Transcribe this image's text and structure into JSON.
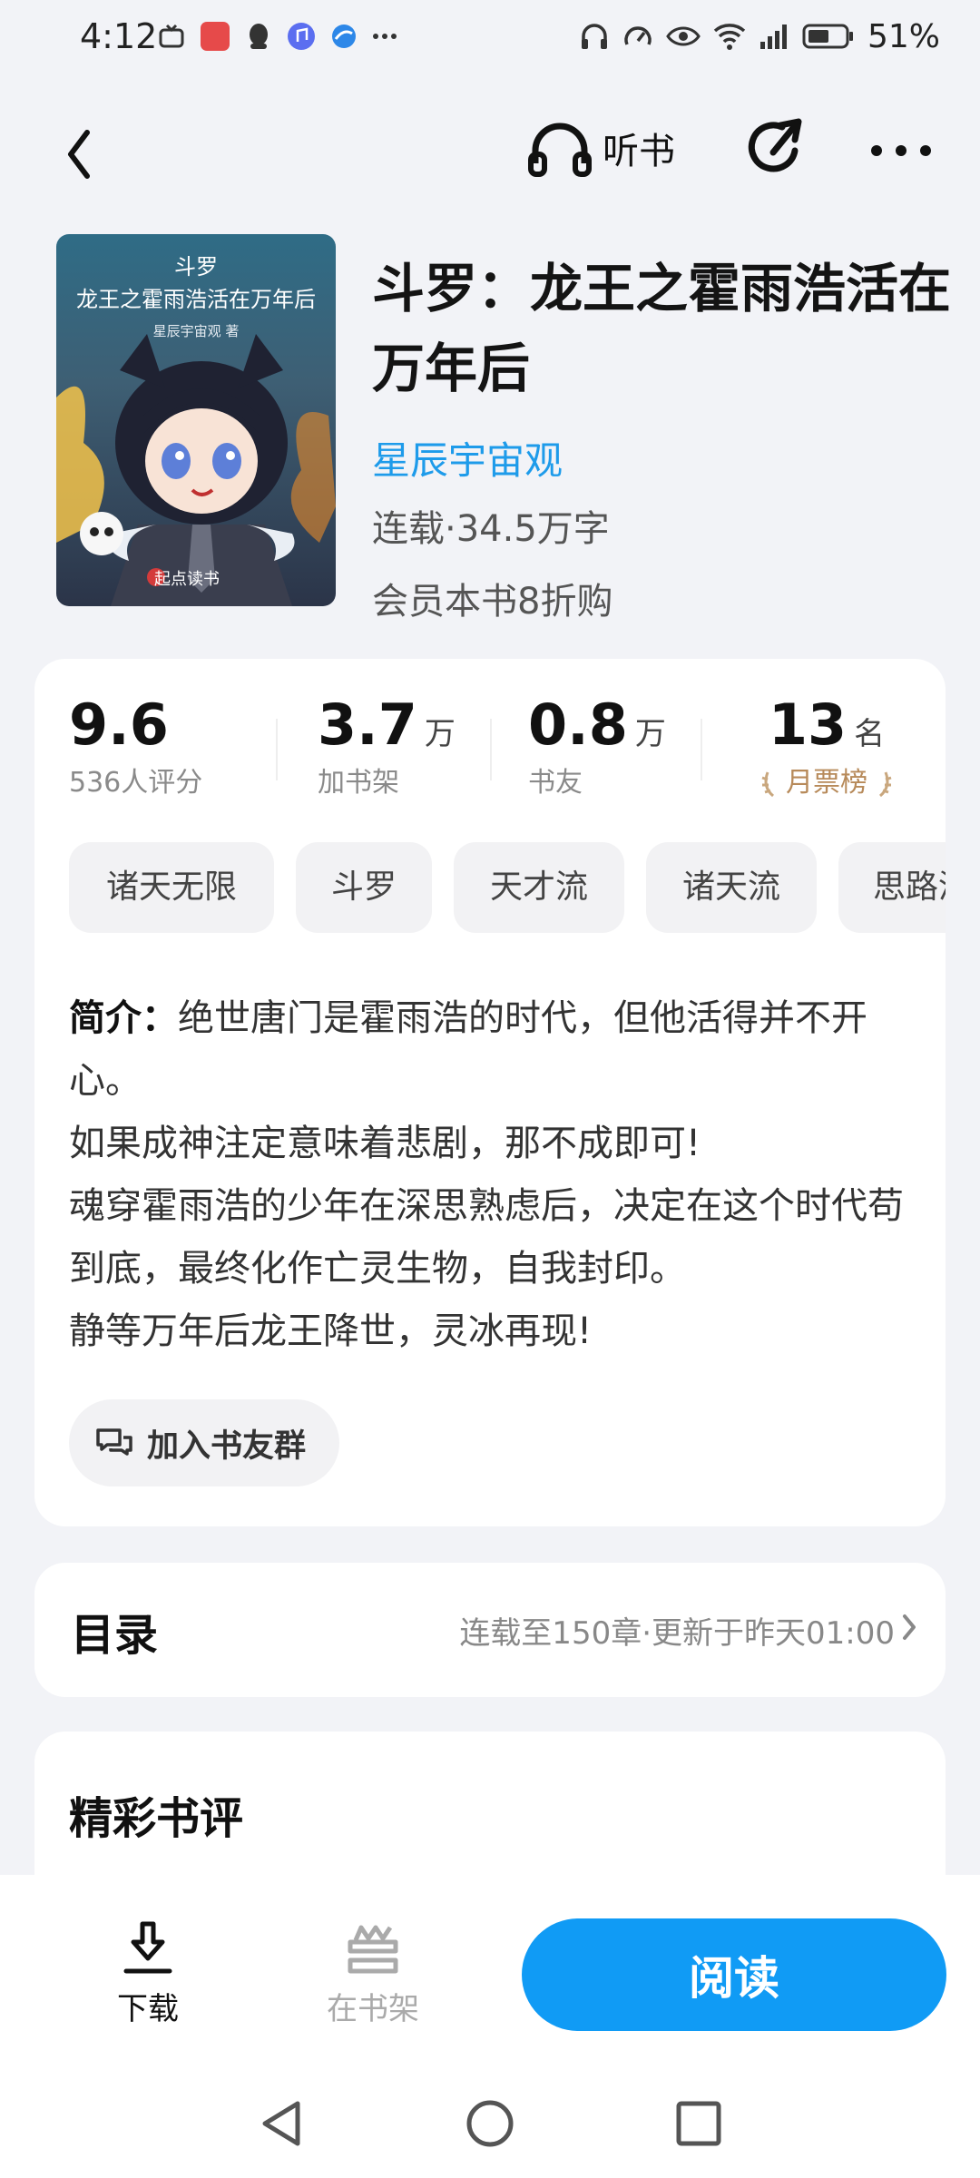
{
  "status_bar": {
    "time": "4:12",
    "battery": "51%"
  },
  "nav": {
    "listen_label": "听书"
  },
  "book": {
    "cover": {
      "title_line1": "斗罗",
      "title_line2": "龙王之霍雨浩活在万年后",
      "author": "星辰宇宙观 著",
      "brand": "起点读书"
    },
    "title": "斗罗：龙王之霍雨浩活在万年后",
    "author": "星辰宇宙观",
    "meta": "连载·34.5万字",
    "vip_note": "会员本书8折购"
  },
  "stats": {
    "score": {
      "value": "9.6",
      "label": "536人评分"
    },
    "shelf": {
      "value": "3.7",
      "unit": "万",
      "label": "加书架"
    },
    "friends": {
      "value": "0.8",
      "unit": "万",
      "label": "书友"
    },
    "rank": {
      "value": "13",
      "unit": "名",
      "label": "月票榜"
    }
  },
  "tags": [
    "诸天无限",
    "斗罗",
    "天才流",
    "诸天流",
    "思路清奇"
  ],
  "intro": {
    "label": "简介：",
    "first_line": "绝世唐门是霍雨浩的时代，但他活得并不开心。",
    "line2": "如果成神注定意味着悲剧，那不成即可!",
    "line3": "魂穿霍雨浩的少年在深思熟虑后，决定在这个时代苟到底，最终化作亡灵生物，自我封印。",
    "line4": "静等万年后龙王降世，灵冰再现!"
  },
  "group_button": "加入书友群",
  "catalog": {
    "title": "目录",
    "info": "连载至150章·更新于昨天01:00"
  },
  "reviews": {
    "title": "精彩书评"
  },
  "bottom": {
    "download": "下载",
    "on_shelf": "在书架",
    "read": "阅读"
  },
  "colors": {
    "accent": "#109bf5",
    "author": "#1e9bea",
    "rank_gold": "#b78a5a",
    "background": "#f2f3f7"
  }
}
